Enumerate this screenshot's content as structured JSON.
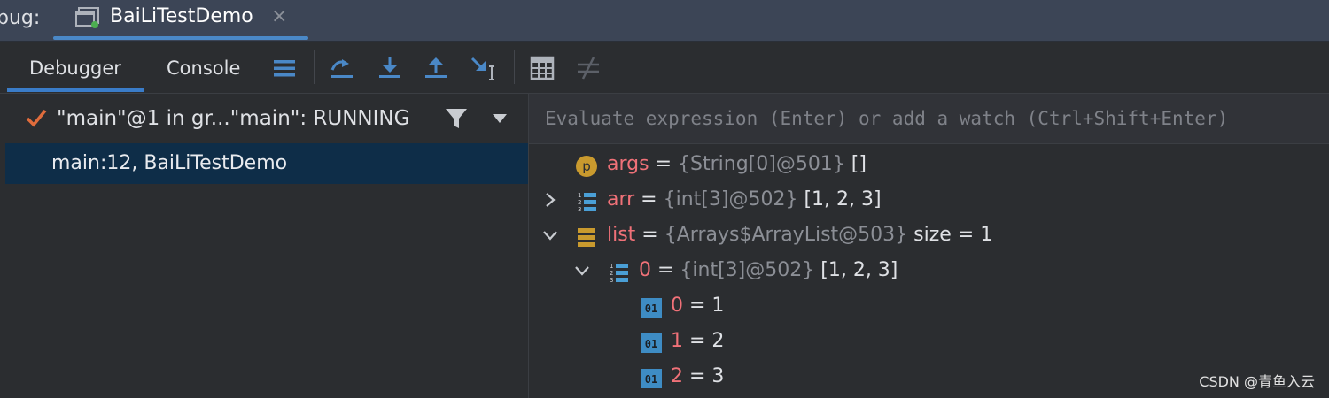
{
  "top": {
    "debug_label": "bug:",
    "tab_title": "BaiLiTestDemo",
    "tab_close": "×"
  },
  "toolbar": {
    "tabs": [
      {
        "label": "Debugger",
        "active": true
      },
      {
        "label": "Console",
        "active": false
      }
    ],
    "buttons": [
      "layout-menu-icon",
      "step-over-icon",
      "step-into-icon",
      "step-out-icon",
      "run-to-cursor-icon",
      "evaluate-expression-icon",
      "mute-breakpoints-icon"
    ]
  },
  "threads": {
    "selected_thread": "\"main\"@1 in gr...\"main\": RUNNING",
    "frames": [
      {
        "label": "main:12, BaiLiTestDemo",
        "selected": true
      }
    ]
  },
  "variables": {
    "eval_placeholder": "Evaluate expression (Enter) or add a watch (Ctrl+Shift+Enter)",
    "rows": [
      {
        "name": "args",
        "eq": " = ",
        "type": "{String[0]@501}",
        "value": " []",
        "icon": "parameter-icon",
        "expand": "none"
      },
      {
        "name": "arr",
        "eq": " = ",
        "type": "{int[3]@502}",
        "value": " [1, 2, 3]",
        "icon": "array-icon",
        "expand": "collapsed"
      },
      {
        "name": "list",
        "eq": " = ",
        "type": "{Arrays$ArrayList@503}",
        "value": "  size = 1",
        "icon": "list-icon",
        "expand": "expanded"
      },
      {
        "name": "0",
        "eq": " = ",
        "type": "{int[3]@502}",
        "value": " [1, 2, 3]",
        "icon": "array-icon",
        "expand": "expanded"
      },
      {
        "name": "0",
        "eq": " = ",
        "type": "",
        "value": "1",
        "icon": "primitive-icon",
        "expand": "none"
      },
      {
        "name": "1",
        "eq": " = ",
        "type": "",
        "value": "2",
        "icon": "primitive-icon",
        "expand": "none"
      },
      {
        "name": "2",
        "eq": " = ",
        "type": "",
        "value": "3",
        "icon": "primitive-icon",
        "expand": "none"
      }
    ]
  },
  "watermark": "CSDN @青鱼入云",
  "colors": {
    "accent": "#3a7cc8",
    "selected_frame": "#0e2d48",
    "var_name": "#f07178",
    "header_bg": "#3c4556"
  }
}
